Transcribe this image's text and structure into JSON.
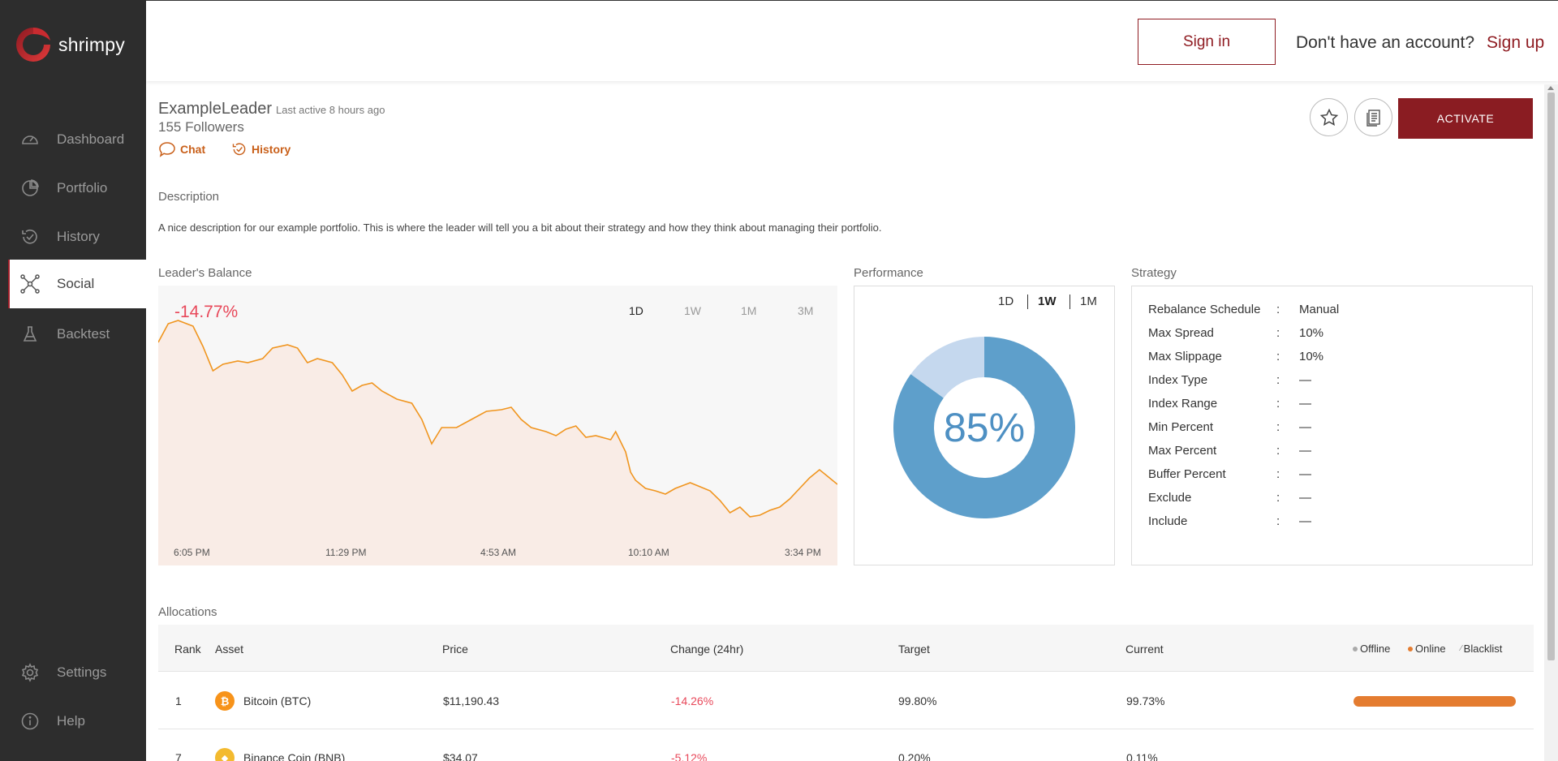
{
  "app": {
    "brand": "shrimpy"
  },
  "sidebar": {
    "items": [
      {
        "label": "Dashboard",
        "icon": "gauge-icon"
      },
      {
        "label": "Portfolio",
        "icon": "pie-chart-icon"
      },
      {
        "label": "History",
        "icon": "history-icon"
      },
      {
        "label": "Social",
        "icon": "network-icon",
        "active": true
      },
      {
        "label": "Backtest",
        "icon": "flask-icon"
      },
      {
        "label": "Settings",
        "icon": "gear-icon"
      },
      {
        "label": "Help",
        "icon": "info-icon"
      }
    ]
  },
  "header": {
    "signin_label": "Sign in",
    "no_account_text": "Don't have an account?",
    "signup_label": "Sign up"
  },
  "leader": {
    "name": "ExampleLeader",
    "last_active": "Last active 8 hours ago",
    "followers": "155 Followers",
    "chat_label": "Chat",
    "history_label": "History",
    "activate_label": "ACTIVATE"
  },
  "description": {
    "title": "Description",
    "text": "A nice description for our example portfolio. This is where the leader will tell you a bit about their strategy and how they think about managing their portfolio."
  },
  "balance": {
    "title": "Leader's Balance",
    "change": "-14.77%",
    "tabs": [
      "1D",
      "1W",
      "1M",
      "3M"
    ],
    "selected_tab": "1D",
    "x_ticks": [
      "6:05 PM",
      "11:29 PM",
      "4:53 AM",
      "10:10 AM",
      "3:34 PM"
    ],
    "line_color": "#f0951f"
  },
  "performance": {
    "title": "Performance",
    "tabs": [
      "1D",
      "1W",
      "1M"
    ],
    "selected_tab": "1W",
    "percent_label": "85%",
    "percent_value": 85,
    "colors": {
      "main": "#5e9fcb",
      "rest": "#c5d8ee"
    }
  },
  "strategy": {
    "title": "Strategy",
    "rows": [
      {
        "key": "Rebalance Schedule",
        "sep": ":",
        "value": "Manual"
      },
      {
        "key": "Max Spread",
        "sep": ":",
        "value": "10%"
      },
      {
        "key": "Max Slippage",
        "sep": ":",
        "value": "10%"
      },
      {
        "key": "Index Type",
        "sep": ":",
        "value": "—"
      },
      {
        "key": "Index Range",
        "sep": ":",
        "value": "—"
      },
      {
        "key": "Min Percent",
        "sep": ":",
        "value": "—"
      },
      {
        "key": "Max Percent",
        "sep": ":",
        "value": "—"
      },
      {
        "key": "Buffer Percent",
        "sep": ":",
        "value": "—"
      },
      {
        "key": "Exclude",
        "sep": ":",
        "value": "—"
      },
      {
        "key": "Include",
        "sep": ":",
        "value": "—"
      }
    ]
  },
  "allocations": {
    "title": "Allocations",
    "columns": [
      "Rank",
      "Asset",
      "Price",
      "Change (24hr)",
      "Target",
      "Current"
    ],
    "legend": [
      {
        "label": "Offline",
        "color": "#aaaaaa"
      },
      {
        "label": "Online",
        "color": "#e47c30"
      },
      {
        "label": "Blacklist",
        "color": "#888888"
      }
    ],
    "rows": [
      {
        "rank": "1",
        "asset": "Bitcoin (BTC)",
        "icon_glyph": "₿",
        "icon_color": "#f7931a",
        "price": "$11,190.43",
        "change": "-14.26%",
        "target": "99.80%",
        "current": "99.73%",
        "current_fraction": 0.9973
      },
      {
        "rank": "7",
        "asset": "Binance Coin (BNB)",
        "icon_glyph": "◆",
        "icon_color": "#f3ba2f",
        "price": "$34.07",
        "change": "-5.12%",
        "target": "0.20%",
        "current": "0.11%",
        "current_fraction": 0.0011
      }
    ]
  }
}
